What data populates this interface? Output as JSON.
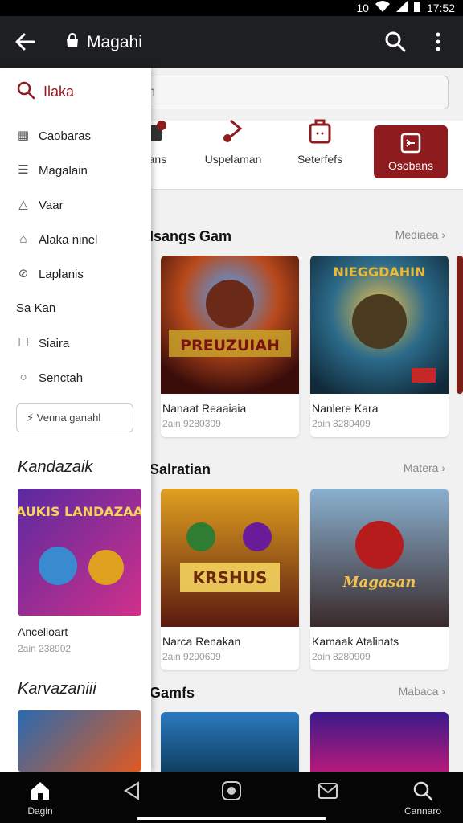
{
  "status_bar": {
    "time": "17:52",
    "extra": "10"
  },
  "app_bar": {
    "title": "Magahi"
  },
  "search": {
    "label": "Ilaka",
    "placeholder": "Naekaan"
  },
  "categories": [
    {
      "label": "aans"
    },
    {
      "label": "Uspelaman"
    },
    {
      "label": "Seterfefs"
    },
    {
      "label": "Osobans"
    }
  ],
  "drawer": {
    "items": [
      {
        "label": "Caobaras",
        "icon": "grid-icon"
      },
      {
        "label": "Magalain",
        "icon": "list-icon"
      },
      {
        "label": "Vaar",
        "icon": "triangle-icon"
      },
      {
        "label": "Alaka ninel",
        "icon": "bell-icon"
      },
      {
        "label": "Laplanis",
        "icon": "link-icon"
      },
      {
        "label": "Sa Kan",
        "icon": "text-icon"
      },
      {
        "label": "Siaira",
        "icon": "square-icon"
      },
      {
        "label": "Senctah",
        "icon": "search-icon"
      }
    ],
    "button_label": "Venna ganahl",
    "section1": "Kandazaik",
    "card": {
      "name": "Ancelloart",
      "meta": "2ain 238902",
      "art_text": "GAUKIS LANDAZAAN"
    },
    "section2": "Karvazaniii"
  },
  "sections": [
    {
      "title": "Isangs Gam",
      "more": "Mediaea",
      "cards": [
        {
          "name": "Nanaat Reaaiaia",
          "meta": "2ain 9280309",
          "art_text": "PREUZUIAH"
        },
        {
          "name": "Nanlere Kara",
          "meta": "2ain 8280409",
          "art_text": "NIEGGDAHIN"
        }
      ]
    },
    {
      "title": "Salratian",
      "more": "Matera",
      "cards": [
        {
          "name": "Narca Renakan",
          "meta": "2ain 9290609",
          "art_text": "KRSHUS"
        },
        {
          "name": "Kamaak Atalinats",
          "meta": "2ain 8280909",
          "art_text": "Magasan"
        }
      ]
    },
    {
      "title": "Gamfs",
      "more": "Mabaca",
      "cards": []
    }
  ],
  "bottom_nav": [
    {
      "label": "Dagin",
      "icon": "home-icon"
    },
    {
      "label": "",
      "icon": "back-icon"
    },
    {
      "label": "",
      "icon": "home-button-icon"
    },
    {
      "label": "",
      "icon": "mail-icon"
    },
    {
      "label": "Cannaro",
      "icon": "search-icon"
    }
  ],
  "colors": {
    "accent": "#8e1b1e",
    "app_bar": "#1e1f22"
  }
}
